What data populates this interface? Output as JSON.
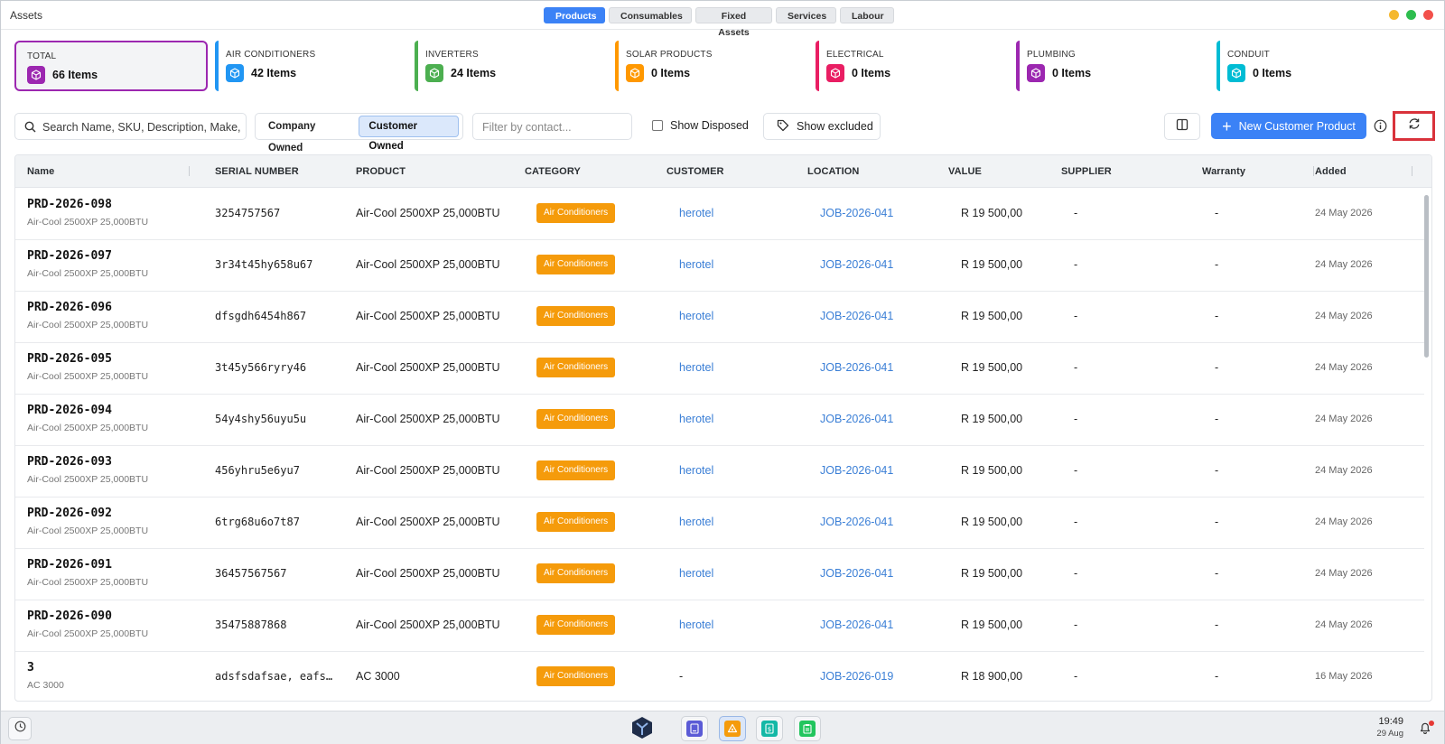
{
  "app": {
    "title": "Assets"
  },
  "top_tabs": [
    {
      "label": "Products",
      "active": true
    },
    {
      "label": "Consumables",
      "active": false
    },
    {
      "label": "Fixed Assets",
      "active": false
    },
    {
      "label": "Services",
      "active": false
    },
    {
      "label": "Labour",
      "active": false
    }
  ],
  "categories": [
    {
      "label": "TOTAL",
      "count": "66 Items",
      "color": "#9c27b0",
      "icon": "box-icon"
    },
    {
      "label": "AIR CONDITIONERS",
      "count": "42 Items",
      "color": "#2196f3",
      "icon": "box-icon"
    },
    {
      "label": "INVERTERS",
      "count": "24 Items",
      "color": "#4caf50",
      "icon": "box-icon"
    },
    {
      "label": "SOLAR PRODUCTS",
      "count": "0 Items",
      "color": "#ff9800",
      "icon": "box-icon"
    },
    {
      "label": "ELECTRICAL",
      "count": "0 Items",
      "color": "#e91e63",
      "icon": "box-icon"
    },
    {
      "label": "PLUMBING",
      "count": "0 Items",
      "color": "#9c27b0",
      "icon": "box-icon"
    },
    {
      "label": "CONDUIT",
      "count": "0 Items",
      "color": "#00bcd4",
      "icon": "box-icon"
    }
  ],
  "toolbar": {
    "search_placeholder": "Search Name, SKU, Description, Make, Model...",
    "ownership": {
      "company": "Company Owned",
      "customer": "Customer Owned",
      "selected": "Customer Owned"
    },
    "contact_placeholder": "Filter by contact...",
    "show_disposed": "Show Disposed",
    "show_excluded": "Show excluded",
    "new_button": "New Customer Product"
  },
  "table": {
    "columns": [
      "Name",
      "SERIAL NUMBER",
      "PRODUCT",
      "CATEGORY",
      "CUSTOMER",
      "LOCATION",
      "VALUE",
      "SUPPLIER",
      "Warranty",
      "Added"
    ],
    "rows": [
      {
        "name": "PRD-2026-098",
        "sub": "Air-Cool 2500XP 25,000BTU",
        "serial": "3254757567",
        "product": "Air-Cool 2500XP 25,000BTU",
        "category": "Air Conditioners",
        "customer": "herotel",
        "location": "JOB-2026-041",
        "value": "R 19 500,00",
        "supplier": "-",
        "warranty": "-",
        "added": "24 May 2026"
      },
      {
        "name": "PRD-2026-097",
        "sub": "Air-Cool 2500XP 25,000BTU",
        "serial": "3r34t45hy658u67",
        "product": "Air-Cool 2500XP 25,000BTU",
        "category": "Air Conditioners",
        "customer": "herotel",
        "location": "JOB-2026-041",
        "value": "R 19 500,00",
        "supplier": "-",
        "warranty": "-",
        "added": "24 May 2026"
      },
      {
        "name": "PRD-2026-096",
        "sub": "Air-Cool 2500XP 25,000BTU",
        "serial": "dfsgdh6454h867",
        "product": "Air-Cool 2500XP 25,000BTU",
        "category": "Air Conditioners",
        "customer": "herotel",
        "location": "JOB-2026-041",
        "value": "R 19 500,00",
        "supplier": "-",
        "warranty": "-",
        "added": "24 May 2026"
      },
      {
        "name": "PRD-2026-095",
        "sub": "Air-Cool 2500XP 25,000BTU",
        "serial": "3t45y566ryry46",
        "product": "Air-Cool 2500XP 25,000BTU",
        "category": "Air Conditioners",
        "customer": "herotel",
        "location": "JOB-2026-041",
        "value": "R 19 500,00",
        "supplier": "-",
        "warranty": "-",
        "added": "24 May 2026"
      },
      {
        "name": "PRD-2026-094",
        "sub": "Air-Cool 2500XP 25,000BTU",
        "serial": "54y4shy56uyu5u",
        "product": "Air-Cool 2500XP 25,000BTU",
        "category": "Air Conditioners",
        "customer": "herotel",
        "location": "JOB-2026-041",
        "value": "R 19 500,00",
        "supplier": "-",
        "warranty": "-",
        "added": "24 May 2026"
      },
      {
        "name": "PRD-2026-093",
        "sub": "Air-Cool 2500XP 25,000BTU",
        "serial": "456yhru5e6yu7",
        "product": "Air-Cool 2500XP 25,000BTU",
        "category": "Air Conditioners",
        "customer": "herotel",
        "location": "JOB-2026-041",
        "value": "R 19 500,00",
        "supplier": "-",
        "warranty": "-",
        "added": "24 May 2026"
      },
      {
        "name": "PRD-2026-092",
        "sub": "Air-Cool 2500XP 25,000BTU",
        "serial": "6trg68u6o7t87",
        "product": "Air-Cool 2500XP 25,000BTU",
        "category": "Air Conditioners",
        "customer": "herotel",
        "location": "JOB-2026-041",
        "value": "R 19 500,00",
        "supplier": "-",
        "warranty": "-",
        "added": "24 May 2026"
      },
      {
        "name": "PRD-2026-091",
        "sub": "Air-Cool 2500XP 25,000BTU",
        "serial": "36457567567",
        "product": "Air-Cool 2500XP 25,000BTU",
        "category": "Air Conditioners",
        "customer": "herotel",
        "location": "JOB-2026-041",
        "value": "R 19 500,00",
        "supplier": "-",
        "warranty": "-",
        "added": "24 May 2026"
      },
      {
        "name": "PRD-2026-090",
        "sub": "Air-Cool 2500XP 25,000BTU",
        "serial": "35475887868",
        "product": "Air-Cool 2500XP 25,000BTU",
        "category": "Air Conditioners",
        "customer": "herotel",
        "location": "JOB-2026-041",
        "value": "R 19 500,00",
        "supplier": "-",
        "warranty": "-",
        "added": "24 May 2026"
      },
      {
        "name": "3",
        "sub": "AC 3000",
        "serial": "adsfsdafsae, eafs…",
        "product": "AC 3000",
        "category": "Air Conditioners",
        "customer": "-",
        "location": "JOB-2026-019",
        "value": "R 18 900,00",
        "supplier": "-",
        "warranty": "-",
        "added": "16 May 2026"
      }
    ]
  },
  "taskbar": {
    "time": "19:49",
    "date": "29 Aug",
    "apps": [
      {
        "name": "contacts-app-icon",
        "color": "#5b5bd6",
        "active": false
      },
      {
        "name": "assets-app-icon",
        "color": "#f59b0b",
        "active": true
      },
      {
        "name": "invoice-app-icon",
        "color": "#14b8a6",
        "active": false
      },
      {
        "name": "clipboard-app-icon",
        "color": "#22c55e",
        "active": false
      }
    ]
  }
}
